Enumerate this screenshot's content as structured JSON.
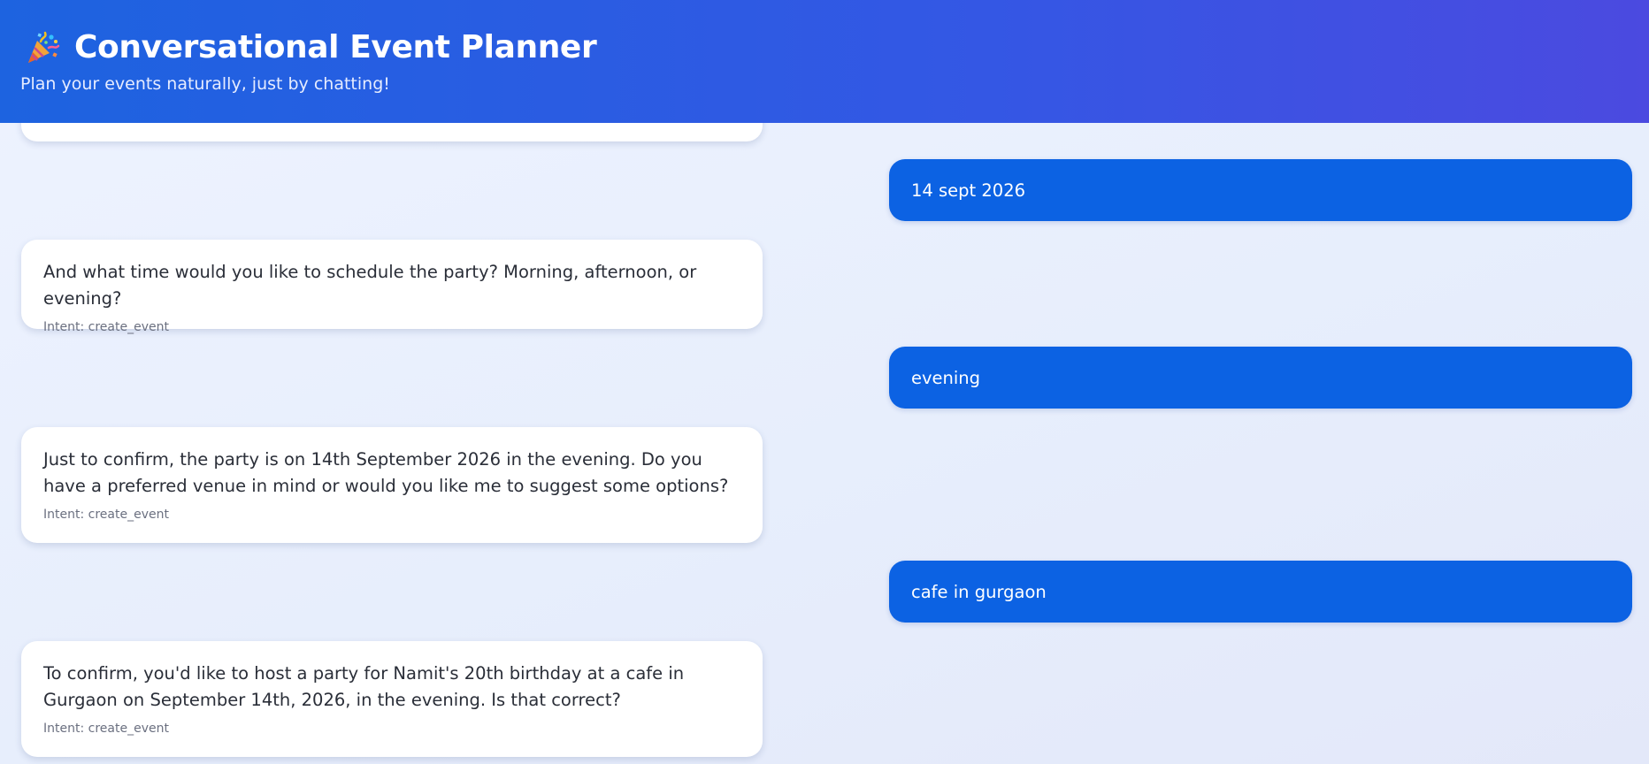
{
  "header": {
    "title": "Conversational Event Planner",
    "subtitle": "Plan your events naturally, just by chatting!",
    "icon": "party-popper-icon"
  },
  "messages": [
    {
      "role": "bot",
      "text": "",
      "intent": ""
    },
    {
      "role": "user",
      "text": "14 sept 2026"
    },
    {
      "role": "bot",
      "text": "And what time would you like to schedule the party? Morning, afternoon, or evening?",
      "intent": "Intent: create_event"
    },
    {
      "role": "user",
      "text": "evening"
    },
    {
      "role": "bot",
      "text": "Just to confirm, the party is on 14th September 2026 in the evening. Do you have a preferred venue in mind or would you like me to suggest some options?",
      "intent": "Intent: create_event"
    },
    {
      "role": "user",
      "text": "cafe in gurgaon"
    },
    {
      "role": "bot",
      "text": "To confirm, you'd like to host a party for Namit's 20th birthday at a cafe in Gurgaon on September 14th, 2026, in the evening. Is that correct?",
      "intent": "Intent: create_event"
    }
  ],
  "colors": {
    "header_start": "#1d63e0",
    "header_end": "#4b4ae0",
    "user_bubble": "#0c62e3",
    "bot_bubble": "#ffffff",
    "background": "#e9effc"
  }
}
